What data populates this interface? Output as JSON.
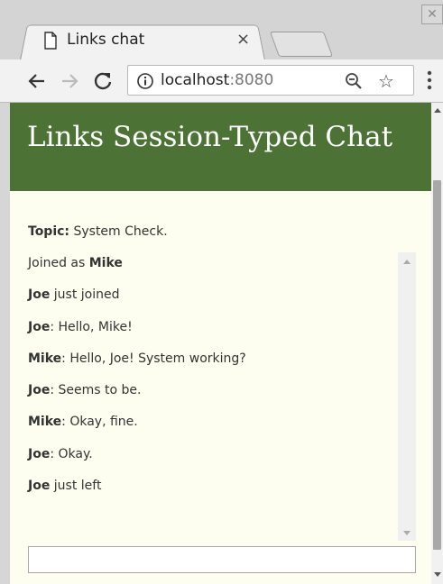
{
  "browser": {
    "tab": {
      "title": "Links chat",
      "close_glyph": "×"
    },
    "window_close_glyph": "✕",
    "url": {
      "host": "localhost",
      "port": ":8080"
    },
    "icons": {
      "back": "back-arrow-icon",
      "forward": "forward-arrow-icon",
      "reload": "reload-icon",
      "info": "info-icon",
      "zoom": "zoom-out-icon",
      "star": "star-icon",
      "menu": "kebab-menu-icon"
    },
    "star_glyph": "☆"
  },
  "page": {
    "title": "Links Session-Typed Chat",
    "header_color": "#4c7335",
    "background_color": "#fefef0",
    "topic": {
      "label": "Topic:",
      "value": " System Check."
    },
    "messages": [
      {
        "pre": "Joined as ",
        "name": "Mike",
        "text": ""
      },
      {
        "pre": "",
        "name": "Joe",
        "text": " just joined"
      },
      {
        "pre": "",
        "name": "Joe",
        "text": ": Hello, Mike!"
      },
      {
        "pre": "",
        "name": "Mike",
        "text": ": Hello, Joe! System working?"
      },
      {
        "pre": "",
        "name": "Joe",
        "text": ": Seems to be."
      },
      {
        "pre": "",
        "name": "Mike",
        "text": ": Okay, fine."
      },
      {
        "pre": "",
        "name": "Joe",
        "text": ": Okay."
      },
      {
        "pre": "",
        "name": "Joe",
        "text": " just left"
      }
    ],
    "input": {
      "value": "",
      "placeholder": ""
    }
  }
}
